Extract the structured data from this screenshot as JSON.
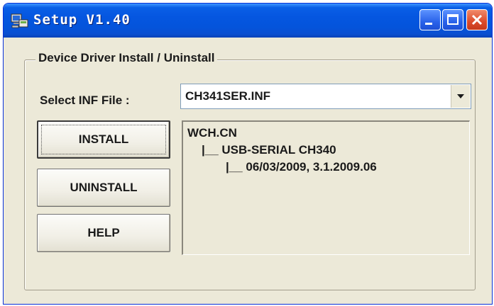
{
  "window": {
    "title": "Setup  V1.40",
    "icon": "setup-computer-icon"
  },
  "titlebar_buttons": {
    "minimize_icon": "minimize-icon",
    "maximize_icon": "maximize-icon",
    "close_icon": "close-icon"
  },
  "group": {
    "legend": "Device Driver Install / Uninstall"
  },
  "inf_select": {
    "label": "Select INF File :",
    "value": "CH341SER.INF",
    "arrow_icon": "chevron-down-icon"
  },
  "buttons": {
    "install": "INSTALL",
    "uninstall": "UNINSTALL",
    "help": "HELP"
  },
  "driver_tree": {
    "vendor": "WCH.CN",
    "device": "|__ USB-SERIAL CH340",
    "version": "|__ 06/03/2009, 3.1.2009.06"
  },
  "colors": {
    "titlebar": "#0556e0",
    "window_face": "#ece9d8",
    "close_button": "#dc4a2a"
  }
}
